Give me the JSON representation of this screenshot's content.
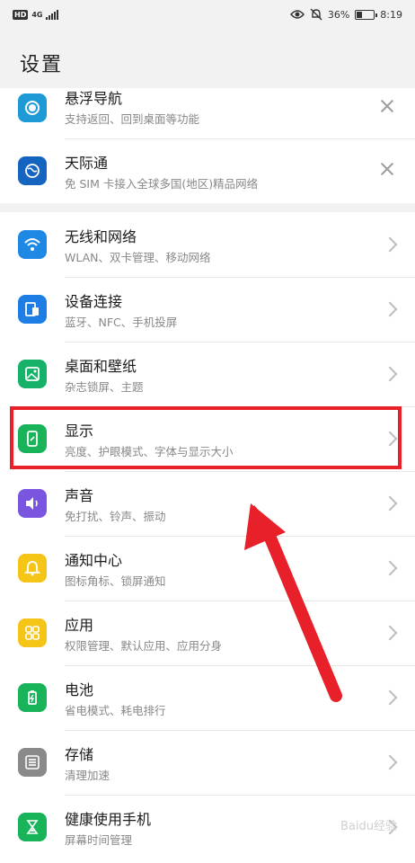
{
  "status_bar": {
    "network": "HD",
    "signal_type": "4G",
    "battery_percent": "36%",
    "time": "8:19",
    "icons": [
      "eye-icon",
      "mute-icon",
      "battery-icon"
    ]
  },
  "header": {
    "title": "设置"
  },
  "pinned": [
    {
      "title": "悬浮导航",
      "subtitle": "支持返回、回到桌面等功能",
      "icon": "float-nav-icon",
      "color": "#1e9ad6"
    },
    {
      "title": "天际通",
      "subtitle": "免 SIM 卡接入全球多国(地区)精品网络",
      "icon": "globe-icon",
      "color": "#1565c0"
    }
  ],
  "settings": [
    {
      "title": "无线和网络",
      "subtitle": "WLAN、双卡管理、移动网络",
      "icon": "wifi-icon",
      "color": "#1e88e5"
    },
    {
      "title": "设备连接",
      "subtitle": "蓝牙、NFC、手机投屏",
      "icon": "device-connect-icon",
      "color": "#1e7ee6"
    },
    {
      "title": "桌面和壁纸",
      "subtitle": "杂志锁屏、主题",
      "icon": "wallpaper-icon",
      "color": "#17b26a"
    },
    {
      "title": "显示",
      "subtitle": "亮度、护眼模式、字体与显示大小",
      "icon": "display-icon",
      "color": "#19b45a"
    },
    {
      "title": "声音",
      "subtitle": "免打扰、铃声、振动",
      "icon": "sound-icon",
      "color": "#7a55e0"
    },
    {
      "title": "通知中心",
      "subtitle": "图标角标、锁屏通知",
      "icon": "bell-icon",
      "color": "#f5c518"
    },
    {
      "title": "应用",
      "subtitle": "权限管理、默认应用、应用分身",
      "icon": "apps-icon",
      "color": "#f5c518"
    },
    {
      "title": "电池",
      "subtitle": "省电模式、耗电排行",
      "icon": "battery-setting-icon",
      "color": "#19b45a"
    },
    {
      "title": "存储",
      "subtitle": "清理加速",
      "icon": "storage-icon",
      "color": "#8a8a8a"
    },
    {
      "title": "健康使用手机",
      "subtitle": "屏幕时间管理",
      "icon": "hourglass-icon",
      "color": "#19b45a"
    }
  ],
  "watermark": "Baidu经验"
}
